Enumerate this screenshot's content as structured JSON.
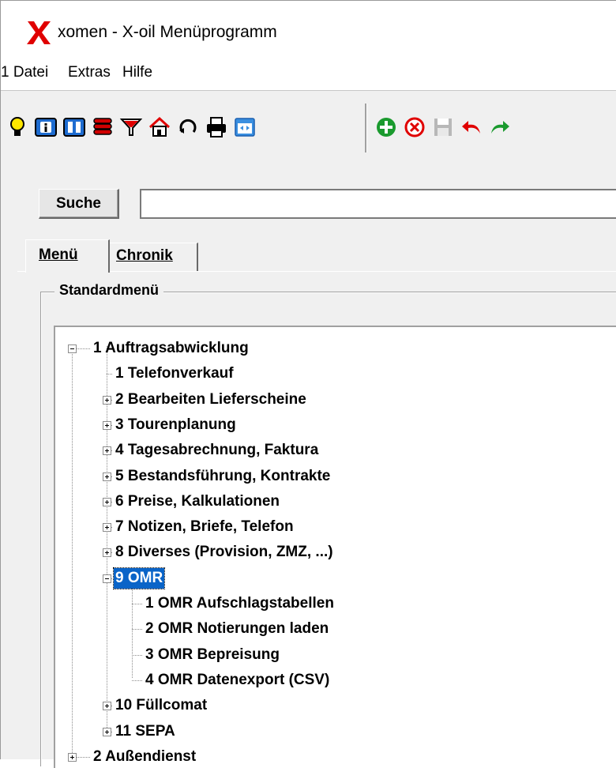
{
  "window": {
    "title": "xomen - X-oil Menüprogramm"
  },
  "menubar": {
    "items": [
      "1 Datei",
      "Extras",
      "Hilfe"
    ]
  },
  "toolbar": {
    "icons": [
      "lightbulb-icon",
      "info-book-icon",
      "book-icon",
      "database-icon",
      "filter-icon",
      "home-icon",
      "refresh-icon",
      "print-icon",
      "window-icon",
      "add-icon",
      "cancel-icon",
      "save-icon",
      "undo-icon",
      "redo-icon"
    ]
  },
  "search": {
    "button_label": "Suche",
    "value": ""
  },
  "tabs": [
    {
      "label": "Menü",
      "active": true
    },
    {
      "label": "Chronik",
      "active": false
    }
  ],
  "group": {
    "label": "Standardmenü"
  },
  "tree": {
    "nodes": [
      {
        "label": "1 Auftragsabwicklung",
        "level": 0,
        "expander": "minus"
      },
      {
        "label": "1 Telefonverkauf",
        "level": 1,
        "expander": "none"
      },
      {
        "label": "2 Bearbeiten Lieferscheine",
        "level": 1,
        "expander": "plus"
      },
      {
        "label": "3 Tourenplanung",
        "level": 1,
        "expander": "plus"
      },
      {
        "label": "4 Tagesabrechnung, Faktura",
        "level": 1,
        "expander": "plus"
      },
      {
        "label": "5 Bestandsführung, Kontrakte",
        "level": 1,
        "expander": "plus"
      },
      {
        "label": "6 Preise,  Kalkulationen",
        "level": 1,
        "expander": "plus"
      },
      {
        "label": "7 Notizen, Briefe, Telefon",
        "level": 1,
        "expander": "plus"
      },
      {
        "label": "8 Diverses (Provision, ZMZ, ...)",
        "level": 1,
        "expander": "plus"
      },
      {
        "label": "9 OMR",
        "level": 1,
        "expander": "minus",
        "selected": true
      },
      {
        "label": "1 OMR Aufschlagstabellen",
        "level": 2,
        "expander": "none"
      },
      {
        "label": "2 OMR Notierungen laden",
        "level": 2,
        "expander": "none"
      },
      {
        "label": "3 OMR Bepreisung",
        "level": 2,
        "expander": "none"
      },
      {
        "label": "4 OMR Datenexport (CSV)",
        "level": 2,
        "expander": "none"
      },
      {
        "label": "10 Füllcomat",
        "level": 1,
        "expander": "plus"
      },
      {
        "label": "11 SEPA",
        "level": 1,
        "expander": "plus"
      },
      {
        "label": "2 Außendienst",
        "level": 0,
        "expander": "plus"
      }
    ]
  },
  "colors": {
    "selection": "#0a64c8",
    "logo_red": "#e00000"
  }
}
